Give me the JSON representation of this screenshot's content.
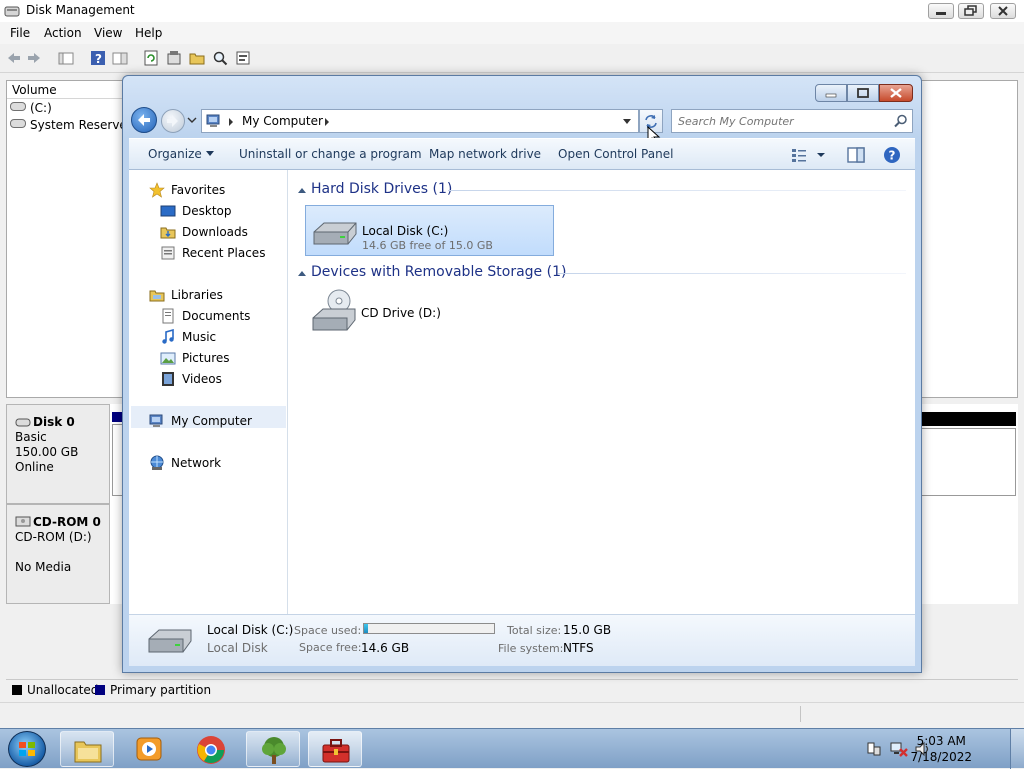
{
  "disk_mgmt": {
    "title": "Disk Management",
    "menu": [
      "File",
      "Action",
      "View",
      "Help"
    ],
    "volume_header": "Volume",
    "volumes": [
      "(C:)",
      "System Reserved"
    ],
    "disks": [
      {
        "name": "Disk 0",
        "type": "Basic",
        "size": "150.00 GB",
        "status": "Online"
      },
      {
        "name": "CD-ROM 0",
        "type": "CD-ROM (D:)",
        "size": "",
        "status": "No Media"
      }
    ],
    "legend": [
      {
        "label": "Unallocated",
        "color": "#000000"
      },
      {
        "label": "Primary partition",
        "color": "#00007f"
      }
    ]
  },
  "explorer": {
    "address": "My Computer",
    "search_placeholder": "Search My Computer",
    "commands": [
      "Organize",
      "Uninstall or change a program",
      "Map network drive",
      "Open Control Panel"
    ],
    "nav": {
      "favorites": "Favorites",
      "favorites_items": [
        "Desktop",
        "Downloads",
        "Recent Places"
      ],
      "libraries": "Libraries",
      "libraries_items": [
        "Documents",
        "Music",
        "Pictures",
        "Videos"
      ],
      "computer": "My Computer",
      "network": "Network"
    },
    "groups": [
      {
        "title": "Hard Disk Drives (1)"
      },
      {
        "title": "Devices with Removable Storage (1)"
      }
    ],
    "drive_c": {
      "name": "Local Disk (C:)",
      "free_text": "14.6 GB free of 15.0 GB"
    },
    "drive_d": {
      "name": "CD Drive (D:)"
    },
    "details": {
      "name": "Local Disk (C:)",
      "type": "Local Disk",
      "space_used_label": "Space used:",
      "space_used_fraction": 0.027,
      "space_free_label": "Space free:",
      "space_free": "14.6 GB",
      "total_size_label": "Total size:",
      "total_size": "15.0 GB",
      "file_system_label": "File system:",
      "file_system": "NTFS"
    }
  },
  "taskbar": {
    "time": "5:03 AM",
    "date": "7/18/2022"
  }
}
